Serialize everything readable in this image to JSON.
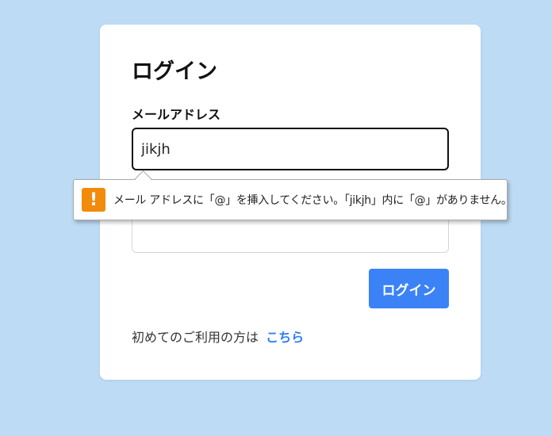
{
  "login": {
    "title": "ログイン",
    "email_label": "メールアドレス",
    "email_value": "jikjh",
    "password_value": "",
    "submit_label": "ログイン",
    "register_prompt": "初めてのご利用の方は",
    "register_link": "こちら"
  },
  "validation": {
    "icon": "warning-icon",
    "icon_glyph": "!",
    "message": "メール アドレスに「@」を挿入してください。「jikjh」内に「@」がありません。"
  },
  "colors": {
    "background": "#bddbf5",
    "accent": "#3b82f6",
    "link": "#2f7ef0",
    "warning": "#f28a0c"
  }
}
